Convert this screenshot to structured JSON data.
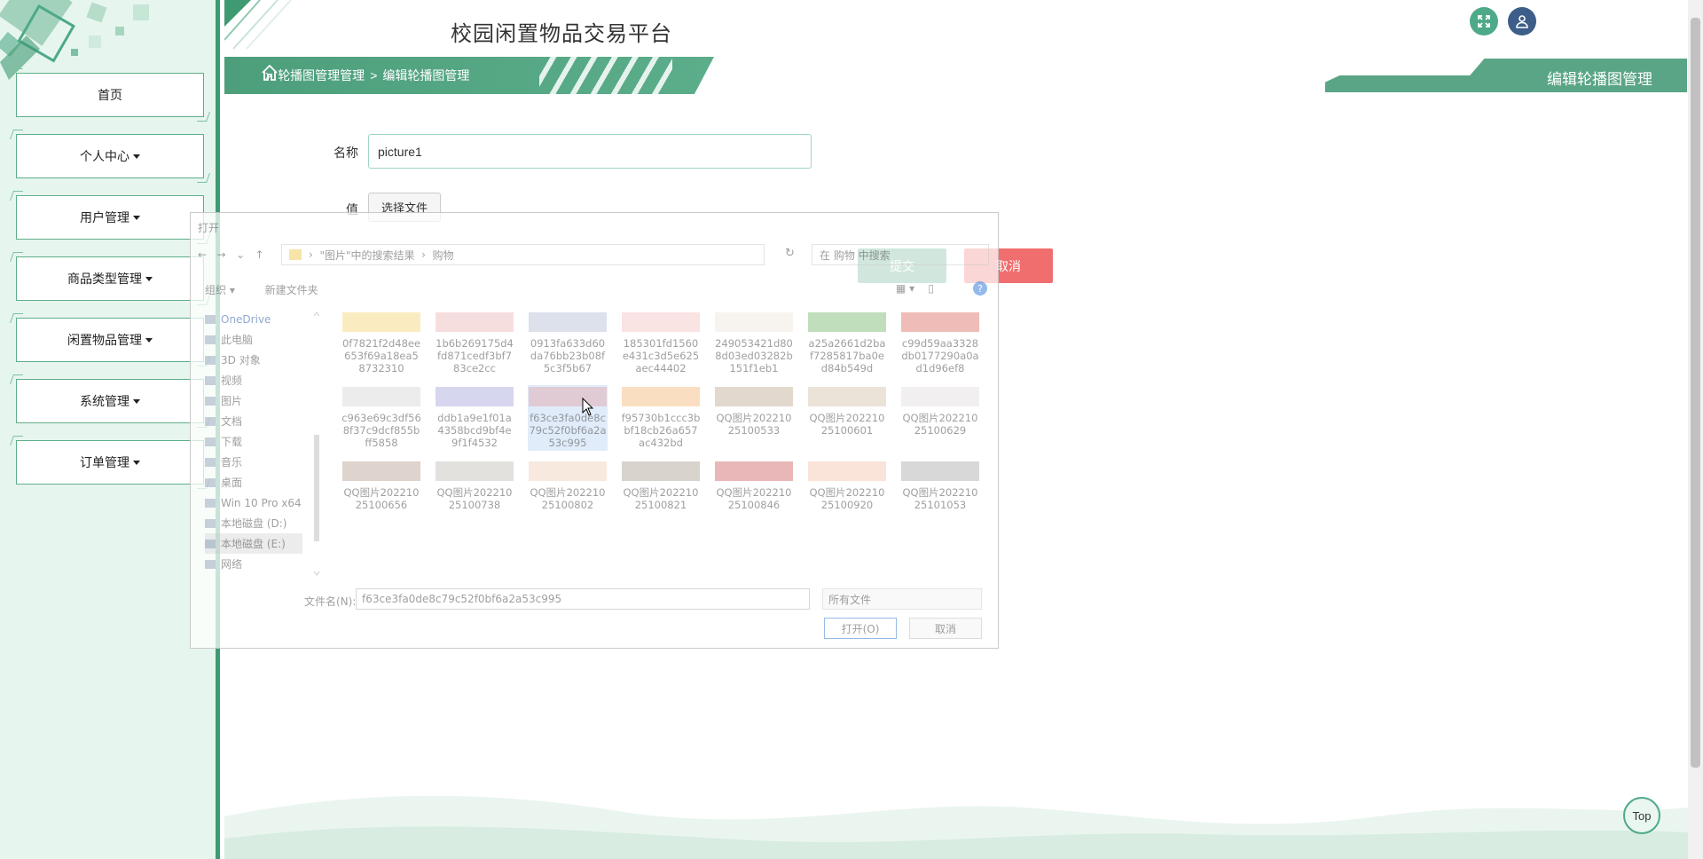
{
  "header": {
    "site_title": "校园闲置物品交易平台",
    "expand_icon": "expand-icon",
    "user_icon": "user-icon"
  },
  "sidebar": {
    "items": [
      {
        "label": "首页",
        "has_caret": false
      },
      {
        "label": "个人中心",
        "has_caret": true
      },
      {
        "label": "用户管理",
        "has_caret": true
      },
      {
        "label": "商品类型管理",
        "has_caret": true
      },
      {
        "label": "闲置物品管理",
        "has_caret": true
      },
      {
        "label": "系统管理",
        "has_caret": true
      },
      {
        "label": "订单管理",
        "has_caret": true
      }
    ]
  },
  "breadcrumb": {
    "sep": ">",
    "items": [
      "轮播图管理管理",
      "编辑轮播图管理"
    ]
  },
  "banner": {
    "title": "编辑轮播图管理"
  },
  "form": {
    "name_label": "名称",
    "name_value": "picture1",
    "value_label": "值",
    "file_button": "选择文件",
    "submit": "提交",
    "cancel": "取消"
  },
  "top_button": "Top",
  "dialog": {
    "title": "打开",
    "address": [
      "\"图片\"中的搜索结果",
      "购物"
    ],
    "search_placeholder": "在 购物 中搜索",
    "tools": [
      "组织 ▾",
      "新建文件夹"
    ],
    "help": "?",
    "sidebar": [
      {
        "label": "OneDrive",
        "cls": "top"
      },
      {
        "label": "此电脑",
        "cls": ""
      },
      {
        "label": "3D 对象",
        "cls": ""
      },
      {
        "label": "视频",
        "cls": ""
      },
      {
        "label": "图片",
        "cls": ""
      },
      {
        "label": "文档",
        "cls": ""
      },
      {
        "label": "下载",
        "cls": ""
      },
      {
        "label": "音乐",
        "cls": ""
      },
      {
        "label": "桌面",
        "cls": ""
      },
      {
        "label": "Win 10 Pro x64",
        "cls": ""
      },
      {
        "label": "本地磁盘 (D:)",
        "cls": ""
      },
      {
        "label": "本地磁盘 (E:)",
        "cls": "selected"
      },
      {
        "label": "网络",
        "cls": ""
      }
    ],
    "files": [
      {
        "name": "0f7821f2d48ee653f69a18ea58732310",
        "color": "#f0c84a"
      },
      {
        "name": "1b6b269175d4fd871cedf3bf783ce2cc",
        "color": "#e8a0a0"
      },
      {
        "name": "0913fa633d60da76bb23b08f5c3f5b67",
        "color": "#9aa8c8"
      },
      {
        "name": "185301fd1560e431c3d5e625aec44402",
        "color": "#f0b0b0"
      },
      {
        "name": "249053421d808d03ed03282b151f1eb1",
        "color": "#e8e0d0"
      },
      {
        "name": "a25a2661d2baf7285817ba0ed84b549d",
        "color": "#4aa040"
      },
      {
        "name": "c99d59aa3328db0177290a0ad1d96ef8",
        "color": "#d04030"
      },
      {
        "name": "c963e69c3df568f37c9dcf855bff5858",
        "color": "#c8c8c8"
      },
      {
        "name": "ddb1a9e1f01a4358bcd9bf4e9f1f4532",
        "color": "#8a8ad0"
      },
      {
        "name": "f63ce3fa0de8c79c52f0bf6a2a53c995",
        "color": "#e09090",
        "selected": true
      },
      {
        "name": "f95730b1ccc3bbf18cb26a657ac432bd",
        "color": "#f0a050"
      },
      {
        "name": "QQ图片20221025100533",
        "color": "#b09070"
      },
      {
        "name": "QQ图片20221025100601",
        "color": "#c8b090"
      },
      {
        "name": "QQ图片20221025100629",
        "color": "#d8d0d0"
      },
      {
        "name": "QQ图片20221025100656",
        "color": "#a08070"
      },
      {
        "name": "QQ图片20221025100738",
        "color": "#b0a8a0"
      },
      {
        "name": "QQ图片20221025100802",
        "color": "#e8c0a0"
      },
      {
        "name": "QQ图片20221025100821",
        "color": "#908070"
      },
      {
        "name": "QQ图片20221025100846",
        "color": "#c03030"
      },
      {
        "name": "QQ图片20221025100920",
        "color": "#f0b090"
      },
      {
        "name": "QQ图片20221025101053",
        "color": "#909090"
      }
    ],
    "filename_label": "文件名(N):",
    "filename_value": "f63ce3fa0de8c79c52f0bf6a2a53c995",
    "filetype": "所有文件",
    "open_button": "打开(O)",
    "cancel_button": "取消"
  }
}
